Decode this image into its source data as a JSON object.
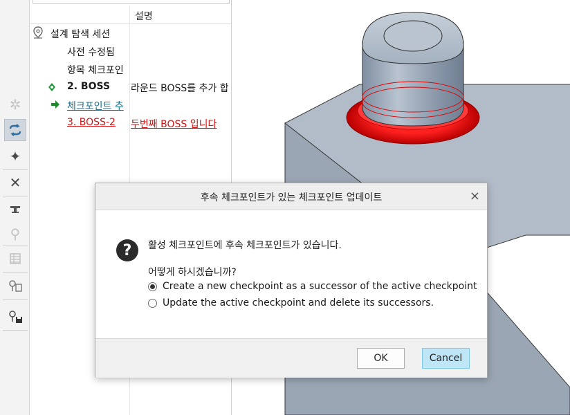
{
  "tree": {
    "column_header_2": "설명",
    "rows": [
      {
        "name": "설계 탐색 세션",
        "desc": ""
      },
      {
        "name": "사전 수정됨",
        "desc": ""
      },
      {
        "name": "항목 체크포인",
        "desc": ""
      },
      {
        "name": "2. BOSS",
        "desc": "라운드 BOSS를 추가 합"
      },
      {
        "name": "체크포인트 추",
        "desc": ""
      },
      {
        "name": "3. BOSS-2",
        "desc": "두번째 BOSS 입니다"
      }
    ]
  },
  "toolbar": {
    "icons": [
      "snowflake-icon",
      "sync-arrows-icon",
      "target-icon",
      "close-icon",
      "anvil-icon",
      "checkpoint-wrench-icon",
      "table-icon",
      "checkpoint-stack-icon",
      "checkpoint-save-icon"
    ]
  },
  "dialog": {
    "title": "후속 체크포인트가 있는 체크포인트 업데이트",
    "close_symbol": "×",
    "icon_symbol": "?",
    "message": "활성 체크포인트에 후속 체크포인트가 있습니다.",
    "question": "어떻게 하시겠습니까?",
    "option_create": "Create a new checkpoint as a successor of the active checkpoint",
    "option_update": "Update the active checkpoint and delete its successors.",
    "selected_option": "create",
    "ok_label": "OK",
    "cancel_label": "Cancel"
  },
  "colors": {
    "highlight_red": "#e00000",
    "part_gray": "#9eaab8",
    "primary_button": "#bfe6f7"
  }
}
